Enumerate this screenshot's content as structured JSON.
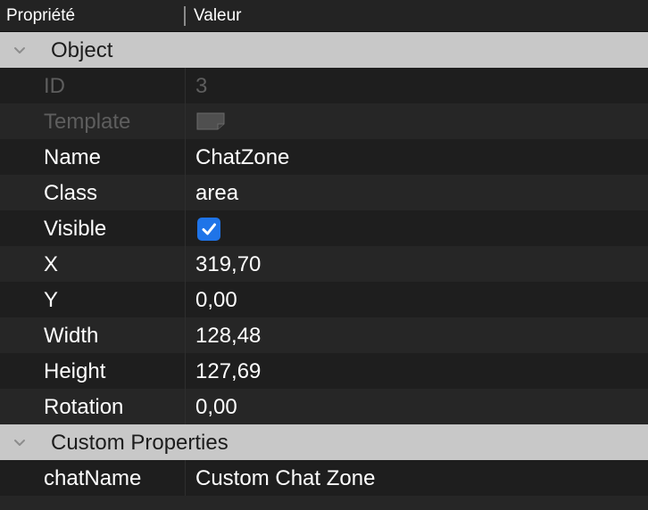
{
  "header": {
    "property_label": "Propriété",
    "value_label": "Valeur"
  },
  "groups": {
    "object": {
      "label": "Object"
    },
    "custom": {
      "label": "Custom Properties"
    }
  },
  "object_rows": [
    {
      "name": "ID",
      "value": "3",
      "enabled": false
    },
    {
      "name": "Template",
      "value_type": "template-checkbox",
      "enabled": false
    },
    {
      "name": "Name",
      "value": "ChatZone",
      "enabled": true
    },
    {
      "name": "Class",
      "value": "area",
      "enabled": true
    },
    {
      "name": "Visible",
      "value_type": "checkbox",
      "checked": true,
      "enabled": true
    },
    {
      "name": "X",
      "value": "319,70",
      "enabled": true
    },
    {
      "name": "Y",
      "value": "0,00",
      "enabled": true
    },
    {
      "name": "Width",
      "value": "128,48",
      "enabled": true
    },
    {
      "name": "Height",
      "value": "127,69",
      "enabled": true
    },
    {
      "name": "Rotation",
      "value": "0,00",
      "enabled": true
    }
  ],
  "custom_rows": [
    {
      "name": "chatName",
      "value": "Custom Chat Zone",
      "enabled": true
    }
  ],
  "colors": {
    "background": "#1e1e1e",
    "row_alt": "#262626",
    "group_header": "#c8c8c8",
    "disabled_text": "#5e5e5e",
    "checkbox_accent": "#1f74e8"
  }
}
